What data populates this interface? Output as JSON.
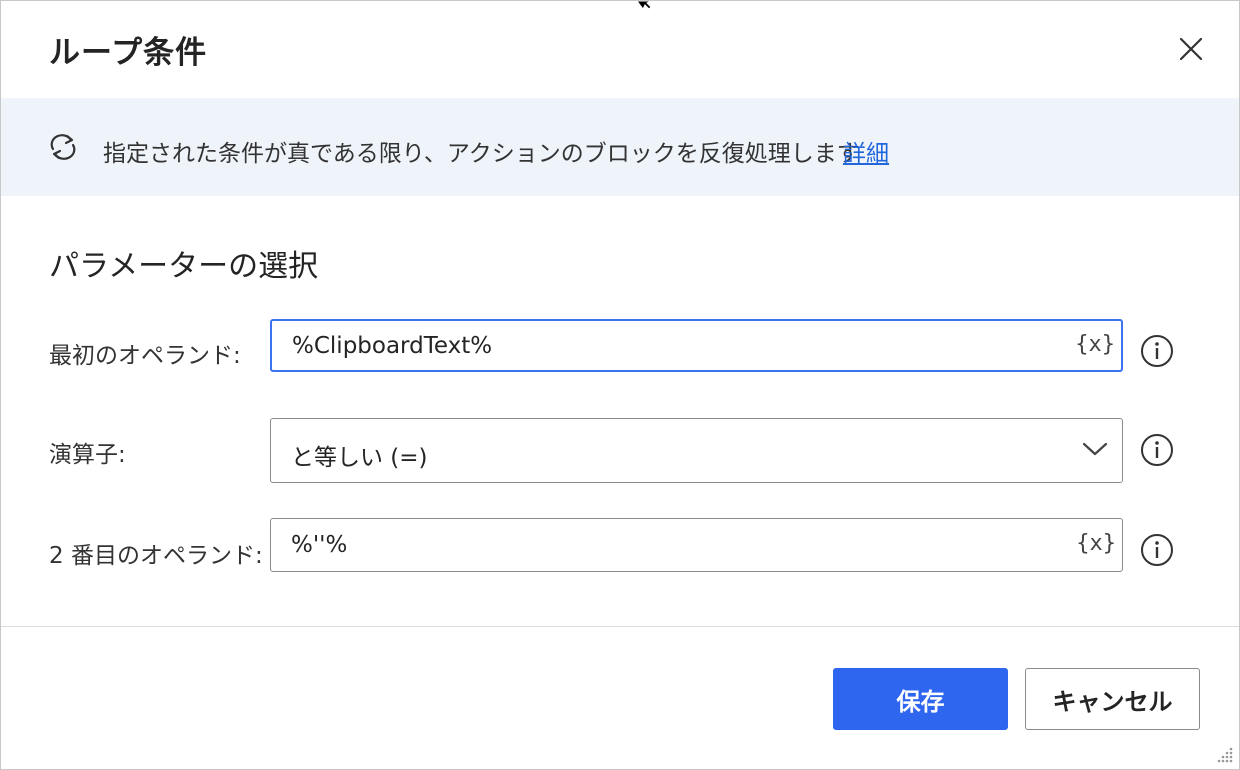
{
  "dialog": {
    "title": "ループ条件"
  },
  "info": {
    "description": "指定された条件が真である限り、アクションのブロックを反復処理します",
    "more_link": "詳細"
  },
  "section": {
    "title": "パラメーターの選択"
  },
  "fields": {
    "first_operand": {
      "label": "最初のオペランド:",
      "value": "%ClipboardText%",
      "var_button": "{x}"
    },
    "operator": {
      "label": "演算子:",
      "value": "と等しい (=)"
    },
    "second_operand": {
      "label": "2 番目のオペランド:",
      "value": "%''%",
      "var_button": "{x}"
    }
  },
  "buttons": {
    "save": "保存",
    "cancel": "キャンセル"
  },
  "colors": {
    "primary": "#2f66f0",
    "focus_border": "#3a74f0",
    "link": "#2266dd",
    "info_bar_bg": "#eff4fa"
  },
  "icons": {
    "close": "close-icon",
    "loop": "loop-icon",
    "variable": "variable-icon",
    "dropdown": "chevron-down-icon",
    "info": "info-icon"
  }
}
